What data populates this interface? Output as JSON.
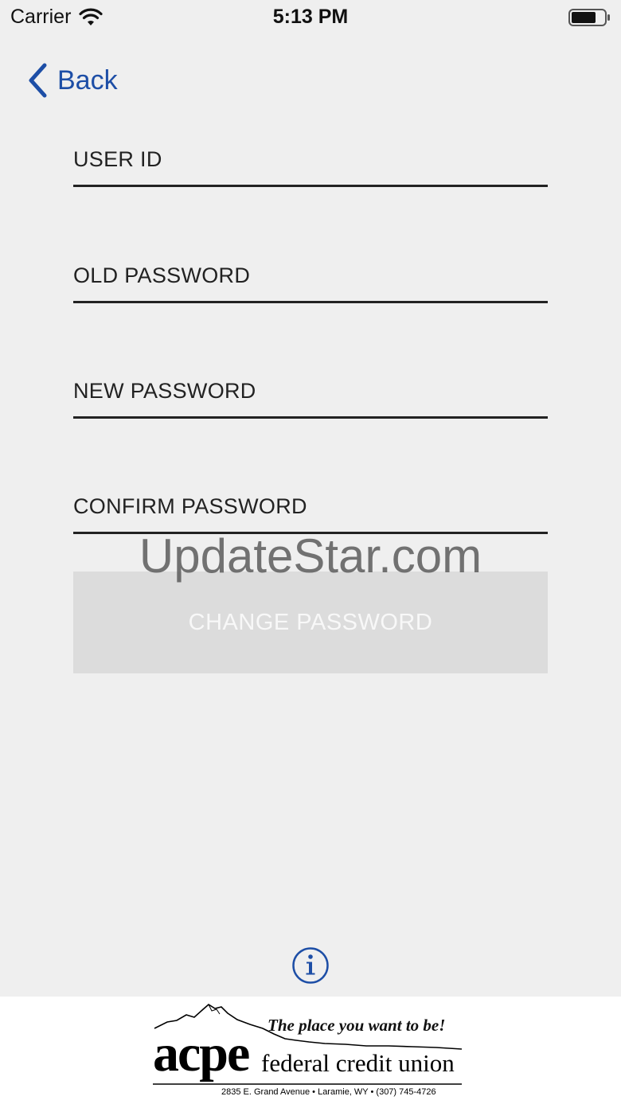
{
  "status_bar": {
    "carrier": "Carrier",
    "time": "5:13 PM"
  },
  "nav": {
    "back_label": "Back"
  },
  "form": {
    "user_id_label": "USER ID",
    "old_password_label": "OLD PASSWORD",
    "new_password_label": "NEW PASSWORD",
    "confirm_password_label": "CONFIRM PASSWORD",
    "submit_label": "CHANGE PASSWORD"
  },
  "watermark": "UpdateStar.com",
  "footer": {
    "slogan": "The place you want to be!",
    "brand_name": "acpe",
    "brand_sub": "federal credit union",
    "address": "2835 E. Grand Avenue • Laramie, WY • (307) 745-4726"
  },
  "colors": {
    "accent": "#1d4ea6",
    "background": "#efefef",
    "button_disabled": "#dcdcdc"
  },
  "icons": [
    "wifi-icon",
    "battery-icon",
    "chevron-left-icon",
    "info-icon"
  ]
}
